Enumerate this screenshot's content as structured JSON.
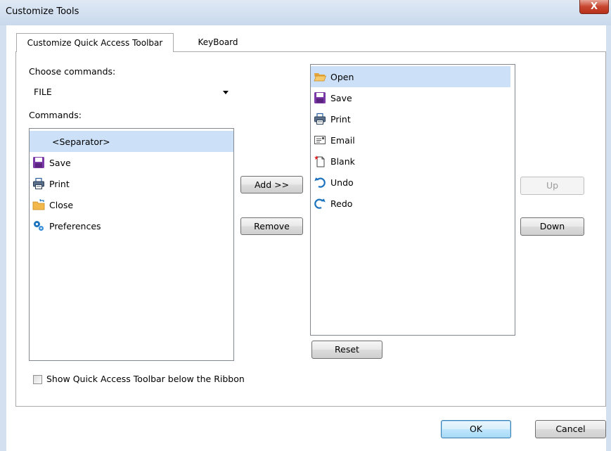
{
  "window": {
    "title": "Customize Tools",
    "close_label": "X"
  },
  "tabs": [
    {
      "label": "Customize Quick Access Toolbar",
      "active": true
    },
    {
      "label": "KeyBoard",
      "active": false
    }
  ],
  "left": {
    "choose_label": "Choose commands:",
    "category_value": "FILE",
    "commands_label": "Commands:",
    "commands": [
      {
        "label": "<Separator>",
        "icon": "none",
        "selected": true
      },
      {
        "label": "Save",
        "icon": "save-icon"
      },
      {
        "label": "Print",
        "icon": "print-icon"
      },
      {
        "label": "Close",
        "icon": "close-folder-icon"
      },
      {
        "label": "Preferences",
        "icon": "gears-icon"
      }
    ]
  },
  "middle": {
    "add_label": "Add >>",
    "remove_label": "Remove"
  },
  "right": {
    "toolbar_items": [
      {
        "label": "Open",
        "icon": "open-folder-icon",
        "selected": true
      },
      {
        "label": "Save",
        "icon": "save-icon"
      },
      {
        "label": "Print",
        "icon": "print-icon"
      },
      {
        "label": "Email",
        "icon": "email-icon"
      },
      {
        "label": "Blank",
        "icon": "blank-page-icon"
      },
      {
        "label": "Undo",
        "icon": "undo-icon"
      },
      {
        "label": "Redo",
        "icon": "redo-icon"
      }
    ],
    "reset_label": "Reset",
    "up_label": "Up",
    "down_label": "Down"
  },
  "options": {
    "show_below_ribbon_label": "Show Quick Access Toolbar below the Ribbon",
    "show_below_ribbon_checked": false
  },
  "footer": {
    "ok_label": "OK",
    "cancel_label": "Cancel"
  },
  "colors": {
    "selection": "#cce0f7",
    "save_purple": "#7b3aa8",
    "accent_blue": "#1e73be",
    "folder_yellow": "#f2b84b"
  }
}
